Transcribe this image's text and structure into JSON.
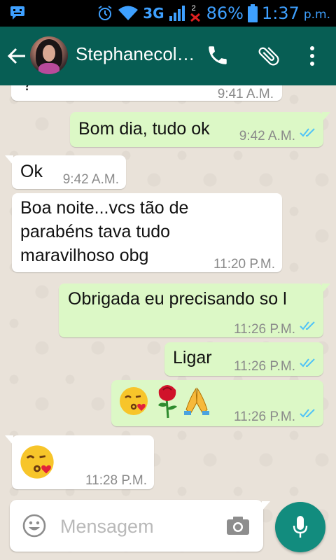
{
  "status_bar": {
    "network": "3G",
    "sim_badge": "2",
    "battery": "86%",
    "time": "1:37",
    "ampm": "p.m."
  },
  "header": {
    "contact_name": "Stephanecol…",
    "icons": [
      "back-arrow-icon",
      "call-icon",
      "attachment-icon",
      "more-options-icon"
    ]
  },
  "messages": [
    {
      "direction": "in",
      "text": "?",
      "time": "9:41 A.M."
    },
    {
      "direction": "out",
      "text": "Bom dia, tudo ok",
      "time": "9:42 A.M.",
      "status": "read"
    },
    {
      "direction": "in",
      "text": "Ok",
      "time": "9:42 A.M."
    },
    {
      "direction": "in",
      "lines": [
        "Boa noite...vcs tão de",
        "parabéns tava tudo",
        "maravilhoso obg"
      ],
      "time": "11:20 P.M."
    },
    {
      "direction": "out",
      "text": "Obrigada eu precisando so l",
      "time": "11:26 P.M.",
      "status": "read"
    },
    {
      "direction": "out",
      "text": "Ligar",
      "time": "11:26 P.M.",
      "status": "read"
    },
    {
      "direction": "out",
      "emojis": [
        "face-blowing-kiss",
        "rose",
        "folded-hands"
      ],
      "time": "11:26 P.M.",
      "status": "read"
    },
    {
      "direction": "in",
      "emojis": [
        "face-blowing-kiss"
      ],
      "time": "11:28 P.M."
    }
  ],
  "composer": {
    "placeholder": "Mensagem"
  },
  "colors": {
    "header": "#075e54",
    "outgoing_bubble": "#dcf8c6",
    "incoming_bubble": "#ffffff",
    "fab": "#128c7e",
    "read_ticks": "#4fc3f7"
  }
}
